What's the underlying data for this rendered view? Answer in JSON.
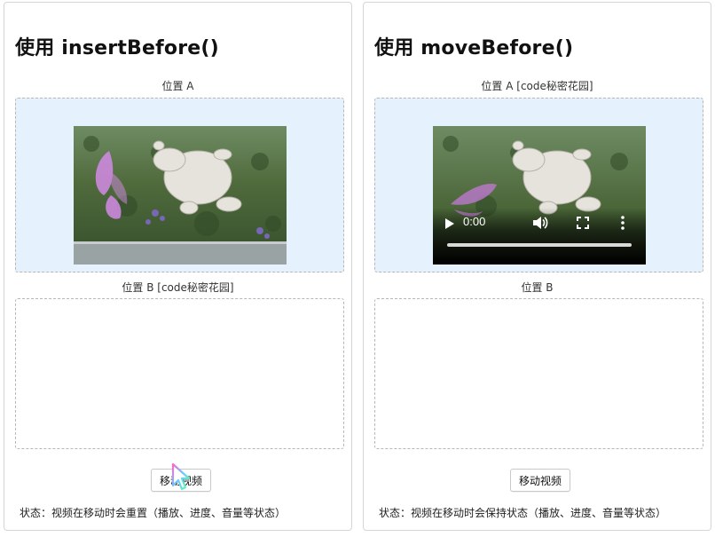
{
  "left_panel": {
    "title": "使用 insertBefore()",
    "slot_a_label": "位置 A",
    "slot_b_label": "位置 B [code秘密花园]",
    "button_label": "移动视频",
    "status": "状态：视频在移动时会重置（播放、进度、音量等状态）",
    "video_state": "reset"
  },
  "right_panel": {
    "title": "使用 moveBefore()",
    "slot_a_label": "位置 A [code秘密花园]",
    "slot_b_label": "位置 B",
    "button_label": "移动视频",
    "status": "状态：视频在移动时会保持状态（播放、进度、音量等状态）",
    "video_time": "0:00",
    "video_state": "preserved"
  },
  "icons": {
    "play": "play-icon",
    "volume": "volume-icon",
    "fullscreen": "fullscreen-icon",
    "more": "more-options-icon",
    "cursor": "mouse-pointer-icon"
  },
  "colors": {
    "slot_a_background": "#e6f1fe",
    "dashed_border": "#b7b7b7",
    "butterfly": "#d48be6",
    "grass": "#4f6b3c"
  }
}
